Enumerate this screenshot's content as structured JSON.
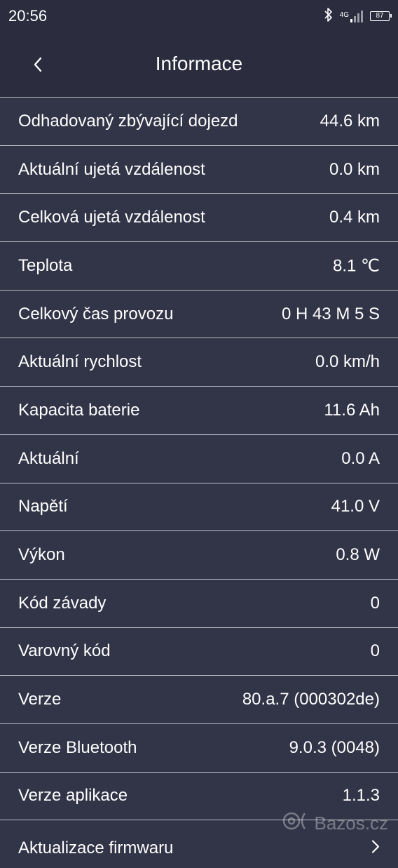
{
  "status_bar": {
    "time": "20:56",
    "network": "4G",
    "battery": "87"
  },
  "header": {
    "title": "Informace"
  },
  "rows": [
    {
      "label": "Odhadovaný zbývající dojezd",
      "value": "44.6 km"
    },
    {
      "label": "Aktuální ujetá vzdálenost",
      "value": "0.0 km"
    },
    {
      "label": "Celková ujetá vzdálenost",
      "value": "0.4 km"
    },
    {
      "label": "Teplota",
      "value": "8.1 ℃"
    },
    {
      "label": "Celkový čas provozu",
      "value": "0 H 43 M 5 S"
    },
    {
      "label": "Aktuální rychlost",
      "value": "0.0 km/h"
    },
    {
      "label": "Kapacita baterie",
      "value": "11.6 Ah"
    },
    {
      "label": "Aktuální",
      "value": "0.0 A"
    },
    {
      "label": "Napětí",
      "value": "41.0 V"
    },
    {
      "label": "Výkon",
      "value": "0.8 W"
    },
    {
      "label": "Kód závady",
      "value": "0"
    },
    {
      "label": "Varovný kód",
      "value": "0"
    },
    {
      "label": "Verze",
      "value": "80.a.7 (000302de)"
    },
    {
      "label": "Verze Bluetooth",
      "value": "9.0.3 (0048)"
    },
    {
      "label": "Verze aplikace",
      "value": "1.1.3"
    }
  ],
  "firmware_row": {
    "label": "Aktualizace firmwaru"
  },
  "watermark": {
    "text": "Bazos.cz"
  }
}
